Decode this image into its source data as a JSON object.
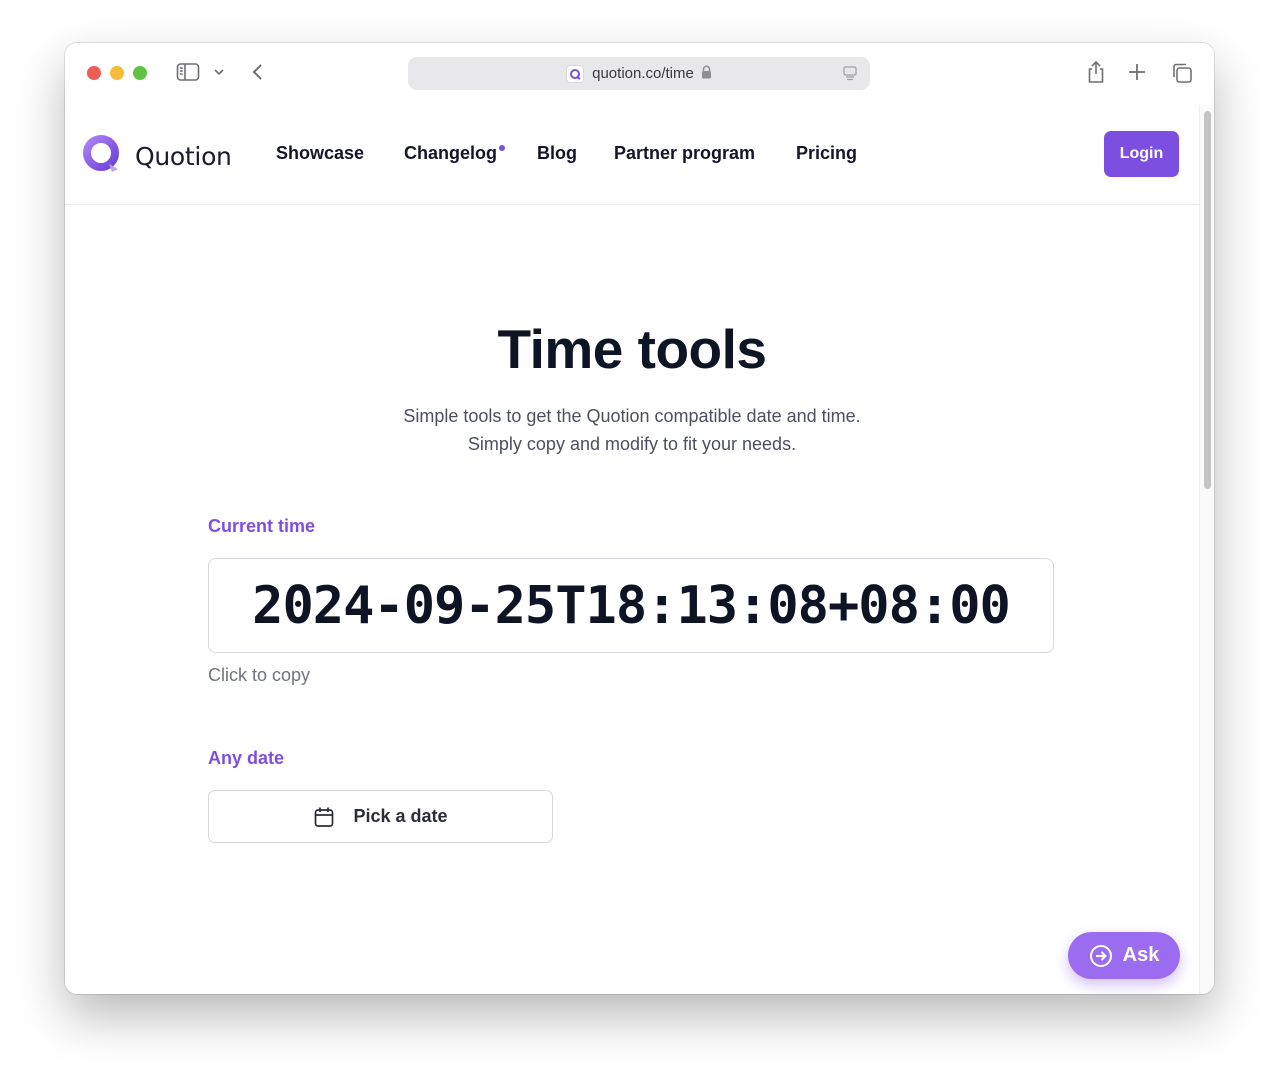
{
  "browser": {
    "url": "quotion.co/time"
  },
  "header": {
    "brand": "Quotion",
    "nav": [
      {
        "label": "Showcase"
      },
      {
        "label": "Changelog"
      },
      {
        "label": "Blog"
      },
      {
        "label": "Partner program"
      },
      {
        "label": "Pricing"
      }
    ],
    "login_label": "Login"
  },
  "main": {
    "title": "Time tools",
    "subtitle": "Simple tools to get the Quotion compatible date and time. Simply copy and modify to fit your needs.",
    "current_time_label": "Current time",
    "current_time_value": "2024-09-25T18:13:08+08:00",
    "copy_hint": "Click to copy",
    "any_date_label": "Any date",
    "pick_date_label": "Pick a date"
  },
  "chat": {
    "ask_label": "Ask"
  },
  "colors": {
    "accent": "#7d4fe0",
    "ask_button": "#9c6cf0"
  }
}
